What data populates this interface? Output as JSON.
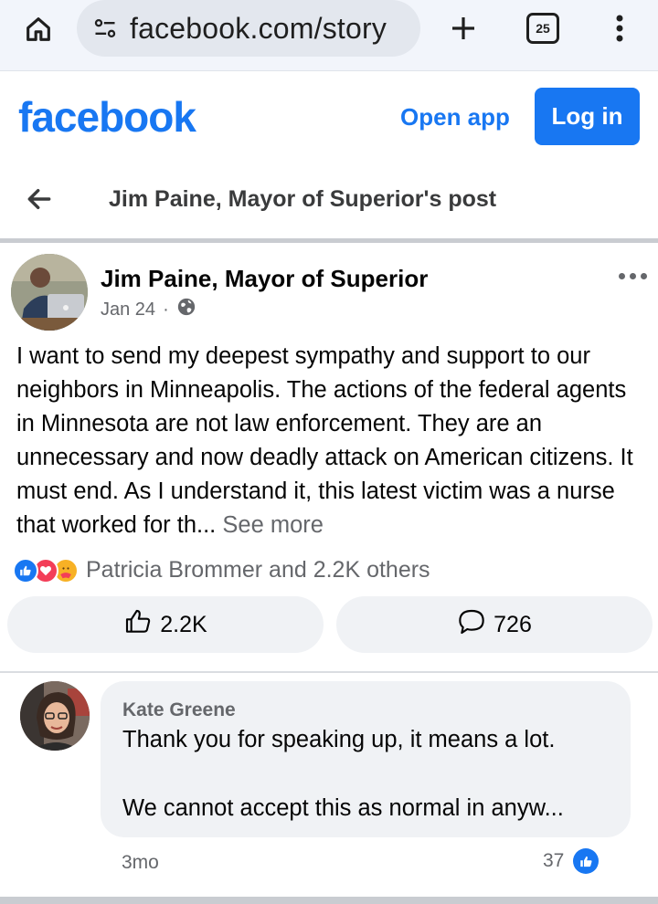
{
  "browser": {
    "url": "facebook.com/story",
    "tab_count": "25",
    "icons": {
      "home": "home-icon",
      "site_settings": "tune-icon",
      "new_tab": "plus-icon",
      "menu": "kebab-menu-icon"
    }
  },
  "header": {
    "logo": "facebook",
    "open_app_label": "Open app",
    "login_label": "Log in"
  },
  "nav": {
    "title": "Jim Paine, Mayor of Superior's post"
  },
  "post": {
    "author": "Jim Paine, Mayor of Superior",
    "date": "Jan 24",
    "separator": "·",
    "text": "I want to send my deepest sympathy and support to our neighbors in Minneapolis. The actions of the federal agents in Minnesota are not law enforcement. They are an unnecessary and now deadly attack on American citizens. It must end. As I understand it, this latest victim was a nurse that worked for th...",
    "see_more": "See more",
    "reactions_summary": "Patricia Brommer and 2.2K others",
    "reaction_types": [
      "like",
      "love",
      "care"
    ],
    "like_count": "2.2K",
    "comment_count": "726"
  },
  "comment": {
    "author": "Kate Greene",
    "line1": "Thank you for speaking up, it means a lot.",
    "line2": "We cannot accept this as normal in anyw...",
    "time": "3mo",
    "likes": "37"
  },
  "colors": {
    "brand": "#1877f2",
    "secondary_text": "#65676b",
    "bubble": "#f0f2f5"
  }
}
